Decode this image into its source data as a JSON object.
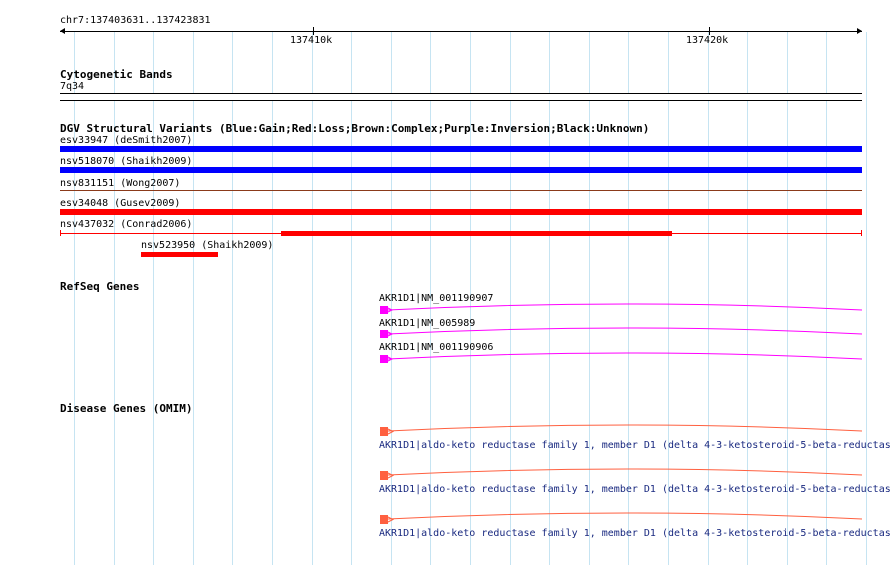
{
  "ruler": {
    "range_label": "chr7:137403631..137423831",
    "tick_labels": [
      "137410k",
      "137420k"
    ]
  },
  "tracks": {
    "cyto": {
      "title": "Cytogenetic Bands",
      "band": "7q34"
    },
    "dgv": {
      "title": "DGV Structural Variants (Blue:Gain;Red:Loss;Brown:Complex;Purple:Inversion;Black:Unknown)",
      "features": [
        {
          "label": "esv33947 (deSmith2007)",
          "type": "gain",
          "color": "#0000ff"
        },
        {
          "label": "nsv518070 (Shaikh2009)",
          "type": "gain",
          "color": "#0000ff"
        },
        {
          "label": "nsv831151 (Wong2007)",
          "type": "complex",
          "color": "#8b3a1a"
        },
        {
          "label": "esv34048 (Gusev2009)",
          "type": "loss",
          "color": "#ff0000"
        },
        {
          "label": "nsv437032 (Conrad2006)",
          "type": "loss",
          "color": "#ff0000"
        },
        {
          "label": "nsv523950 (Shaikh2009)",
          "type": "loss",
          "color": "#ff0000"
        }
      ]
    },
    "refseq": {
      "title": "RefSeq Genes",
      "transcripts": [
        {
          "label": "AKR1D1|NM_001190907",
          "color": "#ff00ff"
        },
        {
          "label": "AKR1D1|NM_005989",
          "color": "#ff00ff"
        },
        {
          "label": "AKR1D1|NM_001190906",
          "color": "#ff00ff"
        }
      ]
    },
    "omim": {
      "title": "Disease Genes (OMIM)",
      "genes": [
        {
          "label": "AKR1D1|aldo-keto reductase family 1, member D1 (delta 4-3-ketosteroid-5-beta-reductas",
          "color": "#ff6040"
        },
        {
          "label": "AKR1D1|aldo-keto reductase family 1, member D1 (delta 4-3-ketosteroid-5-beta-reductas",
          "color": "#ff6040"
        },
        {
          "label": "AKR1D1|aldo-keto reductase family 1, member D1 (delta 4-3-ketosteroid-5-beta-reductas",
          "color": "#ff6040"
        }
      ]
    }
  },
  "colors": {
    "grid": "#c6e4f2",
    "gain": "#0000ff",
    "loss": "#ff0000",
    "refseq": "#ff00ff",
    "omim": "#ff6040",
    "omim_text": "#1a2a80"
  }
}
